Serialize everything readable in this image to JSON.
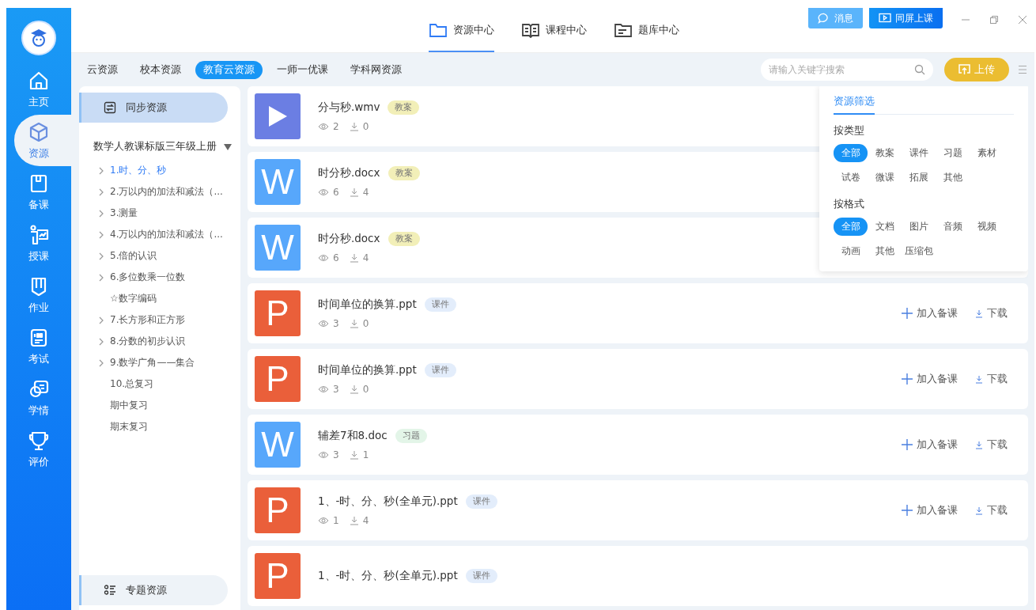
{
  "nav_rail": {
    "items": [
      {
        "kind": "home",
        "label": "主页",
        "selected": false
      },
      {
        "kind": "cube",
        "label": "资源",
        "selected": true
      },
      {
        "kind": "book",
        "label": "备课",
        "selected": false
      },
      {
        "kind": "teach",
        "label": "授课",
        "selected": false
      },
      {
        "kind": "homework",
        "label": "作业",
        "selected": false
      },
      {
        "kind": "exam",
        "label": "考试",
        "selected": false
      },
      {
        "kind": "study",
        "label": "学情",
        "selected": false
      },
      {
        "kind": "trophy",
        "label": "评价",
        "selected": false
      }
    ]
  },
  "top_tabs": [
    {
      "kind": "folder",
      "label": "资源中心",
      "selected": true
    },
    {
      "kind": "book",
      "label": "课程中心",
      "selected": false
    },
    {
      "kind": "list",
      "label": "题库中心",
      "selected": false
    }
  ],
  "header_buttons": [
    {
      "kind": "message",
      "label": "消息"
    },
    {
      "kind": "screen",
      "label": "同屏上课"
    }
  ],
  "source_tabs": [
    {
      "label": "云资源",
      "selected": false
    },
    {
      "label": "校本资源",
      "selected": false
    },
    {
      "label": "教育云资源",
      "selected": true
    },
    {
      "label": "一师一优课",
      "selected": false
    },
    {
      "label": "学科网资源",
      "selected": false
    }
  ],
  "search": {
    "placeholder": "请输入关键字搜索"
  },
  "upload_button": "上传",
  "sidebar": {
    "top_section": {
      "label": "同步资源",
      "selected": true
    },
    "textbook": "数学人教课标版三年级上册",
    "tree": [
      {
        "label": "1.时、分、秒",
        "expandable": true,
        "selected": true
      },
      {
        "label": "2.万以内的加法和减法（...",
        "expandable": true,
        "selected": false
      },
      {
        "label": "3.测量",
        "expandable": true,
        "selected": false
      },
      {
        "label": "4.万以内的加法和减法（...",
        "expandable": true,
        "selected": false
      },
      {
        "label": "5.倍的认识",
        "expandable": true,
        "selected": false
      },
      {
        "label": "6.多位数乘一位数",
        "expandable": true,
        "selected": false
      },
      {
        "label": "☆数字编码",
        "expandable": false,
        "selected": false
      },
      {
        "label": "7.长方形和正方形",
        "expandable": true,
        "selected": false
      },
      {
        "label": "8.分数的初步认识",
        "expandable": true,
        "selected": false
      },
      {
        "label": "9.数学广角——集合",
        "expandable": true,
        "selected": false
      },
      {
        "label": "10.总复习",
        "expandable": false,
        "selected": false
      },
      {
        "label": "期中复习",
        "expandable": false,
        "selected": false
      },
      {
        "label": "期末复习",
        "expandable": false,
        "selected": false
      }
    ],
    "bottom_section": {
      "label": "专题资源",
      "selected": false
    }
  },
  "resources": [
    {
      "kind": "video",
      "name": "分与秒.wmv",
      "tag": {
        "label": "教案",
        "color": "#f2efb8"
      },
      "views": "2",
      "downloads": "0"
    },
    {
      "kind": "word",
      "letter": "W",
      "name": "时分秒.docx",
      "tag": {
        "label": "教案",
        "color": "#f2efb8"
      },
      "views": "6",
      "downloads": "4"
    },
    {
      "kind": "word",
      "letter": "W",
      "name": "时分秒.docx",
      "tag": {
        "label": "教案",
        "color": "#f2efb8"
      },
      "views": "6",
      "downloads": "4"
    },
    {
      "kind": "ppt",
      "letter": "P",
      "name": "时间单位的换算.ppt",
      "tag": {
        "label": "课件",
        "color": "#e3edfb"
      },
      "views": "3",
      "downloads": "0",
      "actions": [
        "加入备课",
        "下载"
      ]
    },
    {
      "kind": "ppt",
      "letter": "P",
      "name": "时间单位的换算.ppt",
      "tag": {
        "label": "课件",
        "color": "#e3edfb"
      },
      "views": "3",
      "downloads": "0",
      "actions": [
        "加入备课",
        "下载"
      ]
    },
    {
      "kind": "word",
      "letter": "W",
      "name": "辅差7和8.doc",
      "tag": {
        "label": "习题",
        "color": "#e3f5e8"
      },
      "views": "3",
      "downloads": "1",
      "actions": [
        "加入备课",
        "下载"
      ]
    },
    {
      "kind": "ppt",
      "letter": "P",
      "name": "1、-时、分、秒(全单元).ppt",
      "tag": {
        "label": "课件",
        "color": "#e3edfb"
      },
      "views": "1",
      "downloads": "4",
      "actions": [
        "加入备课",
        "下载"
      ]
    },
    {
      "kind": "ppt",
      "letter": "P",
      "name": "1、-时、分、秒(全单元).ppt",
      "tag": {
        "label": "课件",
        "color": "#e3edfb"
      }
    }
  ],
  "filter_panel": {
    "title": "资源筛选",
    "groups": [
      {
        "label": "按类型",
        "options": [
          {
            "label": "全部",
            "selected": true
          },
          {
            "label": "教案",
            "selected": false
          },
          {
            "label": "课件",
            "selected": false
          },
          {
            "label": "习题",
            "selected": false
          },
          {
            "label": "素材",
            "selected": false
          },
          {
            "label": "试卷",
            "selected": false
          },
          {
            "label": "微课",
            "selected": false
          },
          {
            "label": "拓展",
            "selected": false
          },
          {
            "label": "其他",
            "selected": false
          }
        ]
      },
      {
        "label": "按格式",
        "options": [
          {
            "label": "全部",
            "selected": true
          },
          {
            "label": "文档",
            "selected": false
          },
          {
            "label": "图片",
            "selected": false
          },
          {
            "label": "音频",
            "selected": false
          },
          {
            "label": "视频",
            "selected": false
          },
          {
            "label": "动画",
            "selected": false
          },
          {
            "label": "其他",
            "selected": false
          },
          {
            "label": "压缩包",
            "selected": false
          }
        ]
      }
    ]
  }
}
